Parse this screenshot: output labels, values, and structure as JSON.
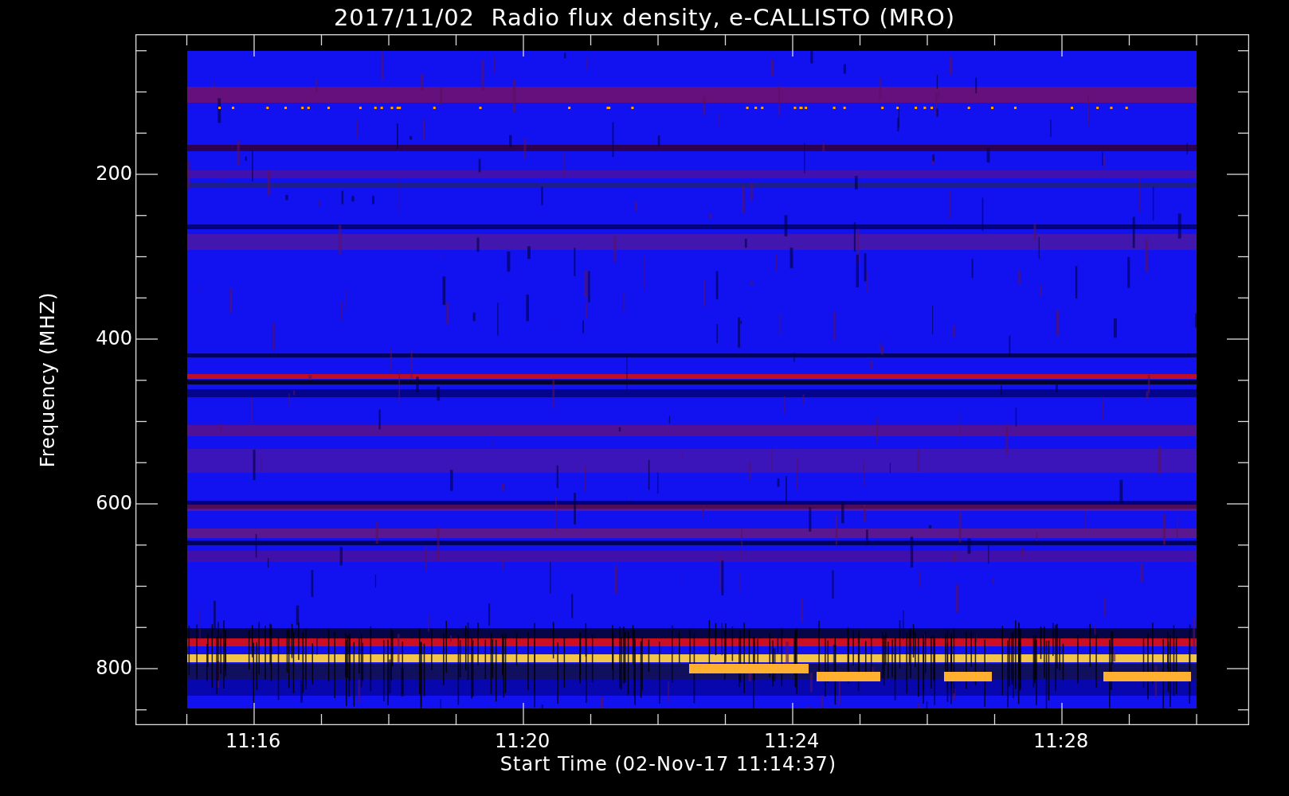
{
  "title": "2017/11/02  Radio flux density, e-CALLISTO (MRO)",
  "y_axis": {
    "label": "Frequency (MHZ)",
    "ticks": [
      "200",
      "400",
      "600",
      "800"
    ]
  },
  "x_axis": {
    "label": "Start Time (02-Nov-17 11:14:37)",
    "ticks": [
      "11:16",
      "11:20",
      "11:24",
      "11:28"
    ]
  }
}
